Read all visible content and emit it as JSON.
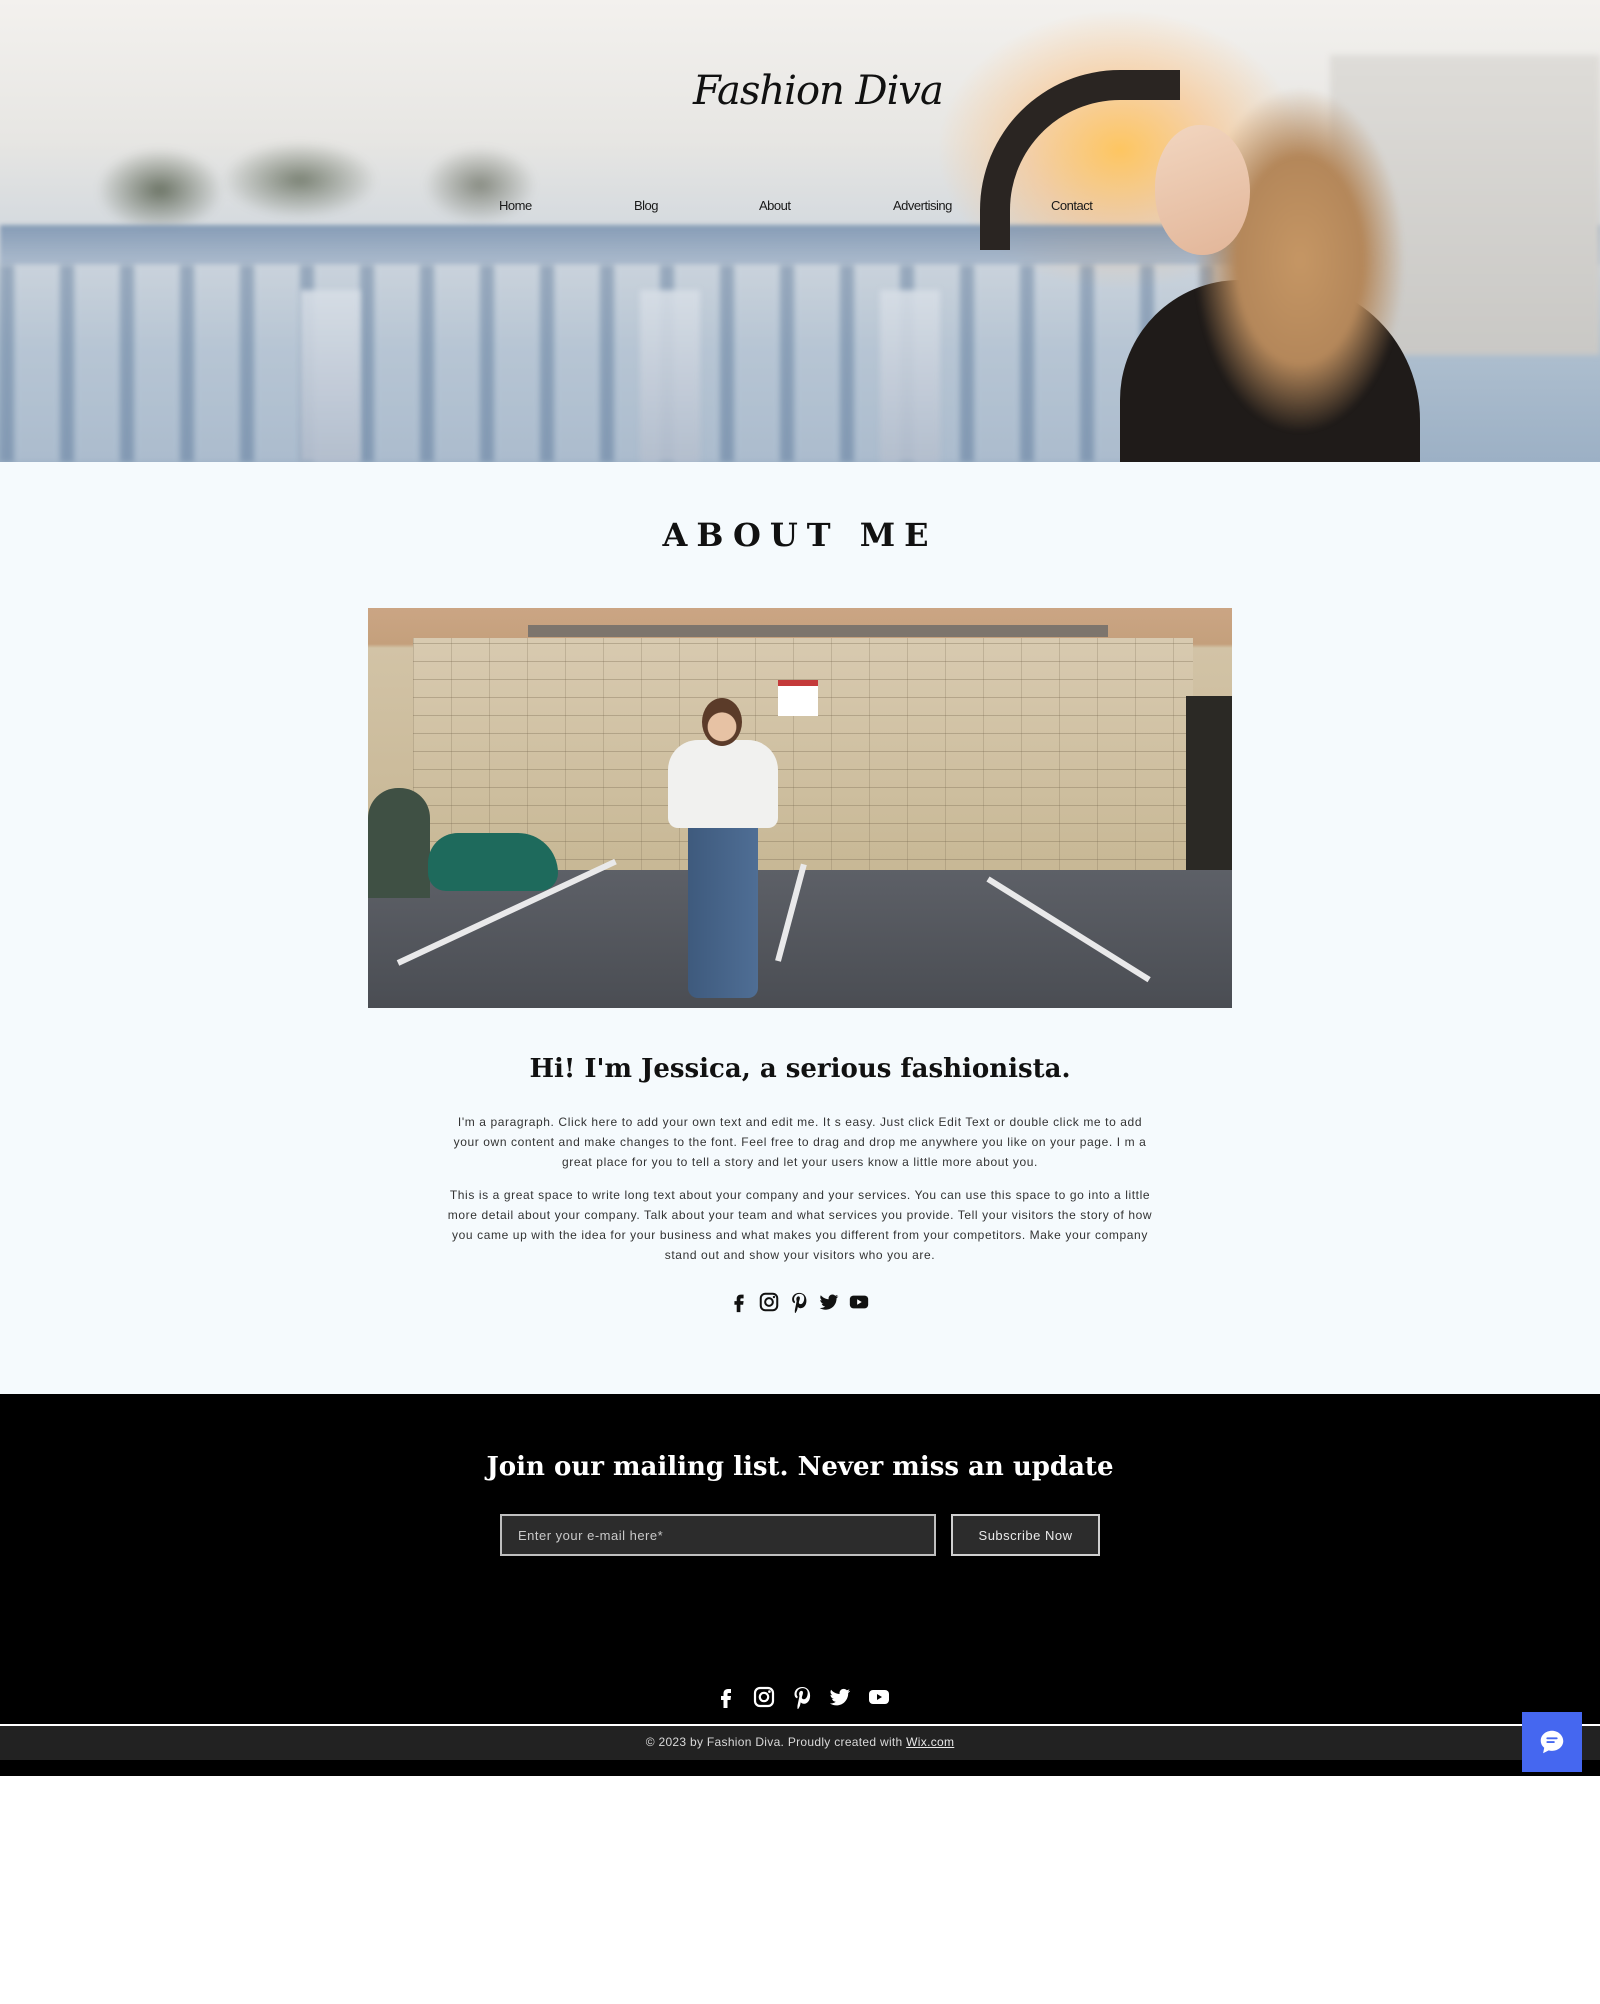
{
  "site": {
    "logo": "Fashion Diva"
  },
  "nav": {
    "items": [
      {
        "label": "Home"
      },
      {
        "label": "Blog"
      },
      {
        "label": "About"
      },
      {
        "label": "Advertising"
      },
      {
        "label": "Contact"
      }
    ]
  },
  "about": {
    "title": "ABOUT ME",
    "heading": "Hi! I'm Jessica, a serious fashionista.",
    "paragraph1": "I'm a paragraph. Click here to add your own text and edit me. It  s easy. Just click   Edit Text   or double click me to add your own content and make changes to the font. Feel free to drag and drop me anywhere you like on your page. I  m a great place for you to tell a story and let your users know a little more about you.",
    "paragraph2": "This is a great space to write long text about your company and your services. You can use this space to go into a little more detail about your company. Talk about your team and what services you provide. Tell your visitors the story of how you came up with the idea for your business and what makes you different from your competitors. Make your company stand out and show your visitors who you are."
  },
  "social_icons": [
    "facebook-icon",
    "instagram-icon",
    "pinterest-icon",
    "twitter-icon",
    "youtube-icon"
  ],
  "newsletter": {
    "title": "Join our mailing list. Never miss an update",
    "email_placeholder": "Enter your e-mail here*",
    "subscribe_label": "Subscribe Now"
  },
  "footer": {
    "copyright_prefix": "© 2023 by Fashion Diva. Proudly created with ",
    "copyright_link": "Wix.com"
  },
  "colors": {
    "about_bg": "#f5fafd",
    "footer_bg": "#000000",
    "footer_bar": "#222222",
    "chat_accent": "#4567f0"
  }
}
